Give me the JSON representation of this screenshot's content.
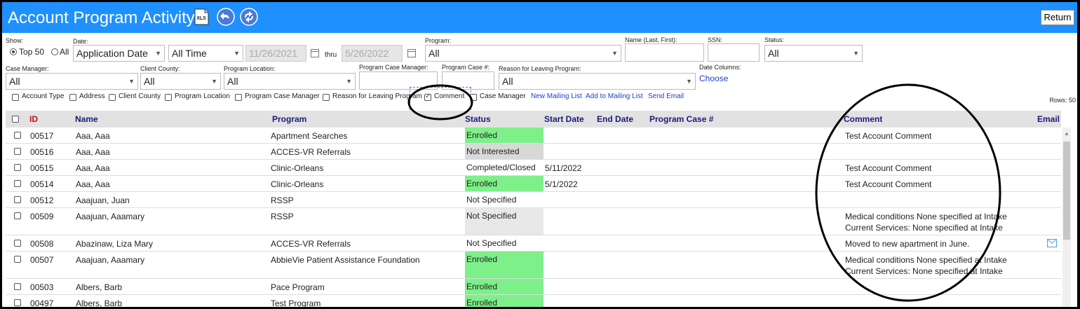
{
  "header": {
    "title": "Account Program Activity",
    "return_label": "Return",
    "xls_label": "XLS"
  },
  "filters": {
    "show_label": "Show:",
    "show_options": [
      "Top 50",
      "All"
    ],
    "date_label": "Date:",
    "date_type": "Application Date",
    "date_range": "All Time",
    "date_from": "11/26/2021",
    "thru_label": "thru",
    "date_to": "5/26/2022",
    "program_label": "Program:",
    "program_value": "All",
    "name_label": "Name (Last, First):",
    "ssn_label": "SSN:",
    "status_label": "Status:",
    "status_value": "All",
    "case_manager_label": "Case Manager:",
    "case_manager_value": "All",
    "client_county_label": "Client County:",
    "client_county_value": "All",
    "program_location_label": "Program Location:",
    "program_location_value": "All",
    "program_case_manager_label": "Program Case Manager:",
    "program_case_num_label": "Program Case #:",
    "reason_label": "Reason for Leaving Program:",
    "reason_value": "All",
    "date_columns_label": "Date Columns:",
    "choose_label": "Choose"
  },
  "columns_options": [
    {
      "label": "Account Type",
      "checked": false
    },
    {
      "label": "Address",
      "checked": false
    },
    {
      "label": "Client County",
      "checked": false
    },
    {
      "label": "Program Location",
      "checked": false
    },
    {
      "label": "Program Case Manager",
      "checked": false
    },
    {
      "label": "Reason for Leaving Program",
      "checked": false
    },
    {
      "label": "Comment",
      "checked": true
    },
    {
      "label": "Case Manager",
      "checked": false
    }
  ],
  "links": {
    "new_mailing_list": "New Mailing List",
    "add_to_mailing_list": "Add to Mailing List",
    "send_email": "Send Email"
  },
  "rows_count_label": "Rows: 50",
  "table": {
    "headers": {
      "id": "ID",
      "name": "Name",
      "program": "Program",
      "status": "Status",
      "start_date": "Start Date",
      "end_date": "End Date",
      "program_case": "Program Case #",
      "comment": "Comment",
      "email": "Email"
    },
    "rows": [
      {
        "id": "00517",
        "name": "Aaa, Aaa",
        "program": "Apartment Searches",
        "status": "Enrolled",
        "status_color": "#7ef08a",
        "start_date": "",
        "comment": "Test Account Comment",
        "comment2": "",
        "email_icon": false
      },
      {
        "id": "00516",
        "name": "Aaa, Aaa",
        "program": "ACCES-VR Referrals",
        "status": "Not Interested",
        "status_color": "#d8d8d8",
        "start_date": "",
        "comment": "",
        "comment2": "",
        "email_icon": false
      },
      {
        "id": "00515",
        "name": "Aaa, Aaa",
        "program": "Clinic-Orleans",
        "status": "Completed/Closed",
        "status_color": "",
        "start_date": "5/11/2022",
        "comment": "Test Account Comment",
        "comment2": "",
        "email_icon": false
      },
      {
        "id": "00514",
        "name": "Aaa, Aaa",
        "program": "Clinic-Orleans",
        "status": "Enrolled",
        "status_color": "#7ef08a",
        "start_date": "5/1/2022",
        "comment": "Test Account Comment",
        "comment2": "",
        "email_icon": false
      },
      {
        "id": "00512",
        "name": "Aaajuan, Juan",
        "program": "RSSP",
        "status": "Not Specified",
        "status_color": "",
        "start_date": "",
        "comment": "",
        "comment2": "",
        "email_icon": false
      },
      {
        "id": "00509",
        "name": "Aaajuan, Aaamary",
        "program": "RSSP",
        "status": "Not Specified",
        "status_color": "#e8e8e8",
        "start_date": "",
        "comment": "Medical conditions None specified at Intake",
        "comment2": "Current Services: None specified at Intake",
        "email_icon": false
      },
      {
        "id": "00508",
        "name": "Abazinaw, Liza Mary",
        "program": "ACCES-VR Referrals",
        "status": "Not Specified",
        "status_color": "",
        "start_date": "",
        "comment": "Moved to new apartment in June.",
        "comment2": "",
        "email_icon": true
      },
      {
        "id": "00507",
        "name": "Aaajuan, Aaamary",
        "program": "AbbieVie Patient Assistance Foundation",
        "status": "Enrolled",
        "status_color": "#7ef08a",
        "start_date": "",
        "comment": "Medical conditions None specified at Intake",
        "comment2": "Current Services: None specified at Intake",
        "email_icon": false
      },
      {
        "id": "00503",
        "name": "Albers, Barb",
        "program": "Pace Program",
        "status": "Enrolled",
        "status_color": "#7ef08a",
        "start_date": "",
        "comment": "",
        "comment2": "",
        "email_icon": false
      },
      {
        "id": "00497",
        "name": "Albers, Barb",
        "program": "Test Program",
        "status": "Enrolled",
        "status_color": "#7ef08a",
        "start_date": "",
        "comment": "",
        "comment2": "",
        "email_icon": false
      }
    ]
  },
  "colors": {
    "header_bar": "#1e90ff",
    "enrolled": "#7ef08a",
    "link": "#1d3fcc",
    "id_header": "#cc1111",
    "annotation": "#000000"
  }
}
